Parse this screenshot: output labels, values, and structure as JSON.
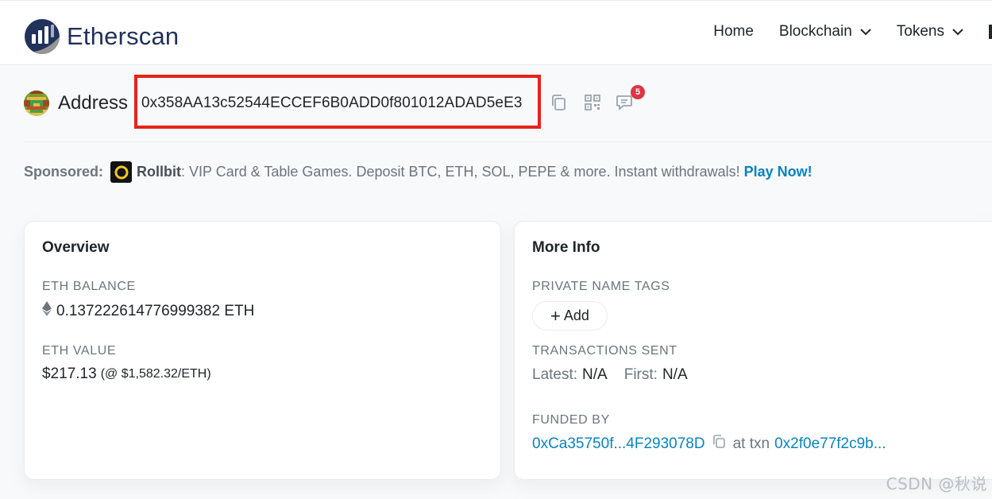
{
  "header": {
    "logo_text": "Etherscan",
    "nav": [
      {
        "label": "Home",
        "has_dropdown": false
      },
      {
        "label": "Blockchain",
        "has_dropdown": true
      },
      {
        "label": "Tokens",
        "has_dropdown": true
      }
    ]
  },
  "address": {
    "label": "Address",
    "hash": "0x358AA13c52544ECCEF6B0ADD0f801012ADAD5eE3",
    "comment_count": "5",
    "highlight_color": "#e8221b"
  },
  "sponsored": {
    "label": "Sponsored:",
    "brand": "Rollbit",
    "text": ": VIP Card & Table Games. Deposit BTC, ETH, SOL, PEPE & more. Instant withdrawals!",
    "link": "Play Now!"
  },
  "overview": {
    "title": "Overview",
    "eth_balance_label": "ETH BALANCE",
    "eth_balance_value": "0.137222614776999382 ETH",
    "eth_value_label": "ETH VALUE",
    "eth_value_amount": "$217.13",
    "eth_value_rate": "(@ $1,582.32/ETH)"
  },
  "more_info": {
    "title": "More Info",
    "private_tags_label": "PRIVATE NAME TAGS",
    "add_label": "Add",
    "tx_sent_label": "TRANSACTIONS SENT",
    "latest_label": "Latest:",
    "latest_value": "N/A",
    "first_label": "First:",
    "first_value": "N/A",
    "funded_by_label": "FUNDED BY",
    "funded_by_address": "0xCa35750f...4F293078D",
    "at_txn_label": "at txn",
    "funded_txn": "0x2f0e77f2c9b..."
  },
  "watermark": "CSDN @秋说",
  "colors": {
    "brand": "#21325b",
    "link": "#0784c3",
    "badge": "#dc3545"
  }
}
